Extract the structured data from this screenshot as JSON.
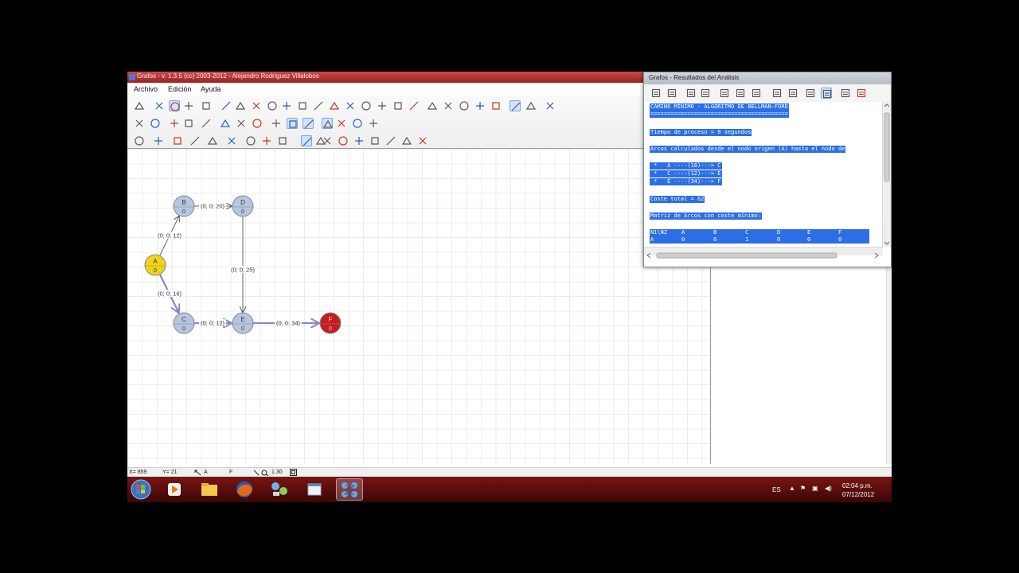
{
  "main_window": {
    "title": "Grafos - v. 1.3.5  (cc) 2003-2012 - Alejandro Rodríguez Villalobos",
    "menus": [
      "Archivo",
      "Edición",
      "Ayuda"
    ]
  },
  "graph": {
    "nodes": [
      {
        "id": "A",
        "value": "0",
        "color": "#f2d21b"
      },
      {
        "id": "B",
        "value": "0",
        "color": "#b7c6dd"
      },
      {
        "id": "C",
        "value": "0",
        "color": "#b7c6dd"
      },
      {
        "id": "D",
        "value": "0",
        "color": "#b7c6dd"
      },
      {
        "id": "E",
        "value": "0",
        "color": "#b7c6dd"
      },
      {
        "id": "F",
        "value": "0",
        "color": "#c81d1d"
      }
    ],
    "edges": [
      {
        "from": "A",
        "to": "B",
        "label": "(0; 0; 12)",
        "highlighted": false
      },
      {
        "from": "A",
        "to": "C",
        "label": "(0; 0; 16)",
        "highlighted": true
      },
      {
        "from": "B",
        "to": "D",
        "label": "(0; 0; 20)",
        "highlighted": false
      },
      {
        "from": "D",
        "to": "E",
        "label": "(0; 0; 25)",
        "highlighted": false
      },
      {
        "from": "C",
        "to": "E",
        "label": "(0; 0; 12)",
        "highlighted": true
      },
      {
        "from": "E",
        "to": "F",
        "label": "(0; 0; 34)",
        "highlighted": true
      }
    ],
    "highlight_color": "#8a86c8"
  },
  "statusbar": {
    "x": "X= 859",
    "y": "Y= 21",
    "node": "A",
    "f": "F",
    "zoom": "1.30"
  },
  "results_window": {
    "title": "Grafos - Resultados del Análisis",
    "lines": {
      "heading": "CAMINO MÍNIMO - ALGORITMO DE BELLMAN-FORD",
      "underline": "=========================================",
      "time": "Tiempo de proceso = 0 segundos",
      "arcs_intro": "Arcos calculados desde el nodo origen (A) hasta el nodo de",
      "path": [
        " *   A ----(16)---> C",
        " *   C ----(12)---> E",
        " *   E ----(34)---> F"
      ],
      "total": "Coste total = 62",
      "matrix_title": "Matriz de Arcos con coste mínimo:"
    },
    "matrix": {
      "header": [
        "N1\\N2",
        "A",
        "B",
        "C",
        "D",
        "E",
        "F"
      ],
      "rows": [
        [
          "A",
          "0",
          "0",
          "1",
          "0",
          "0",
          "0"
        ]
      ]
    }
  },
  "tray": {
    "lang": "ES",
    "time": "02:04 p.m.",
    "date": "07/12/2012"
  }
}
